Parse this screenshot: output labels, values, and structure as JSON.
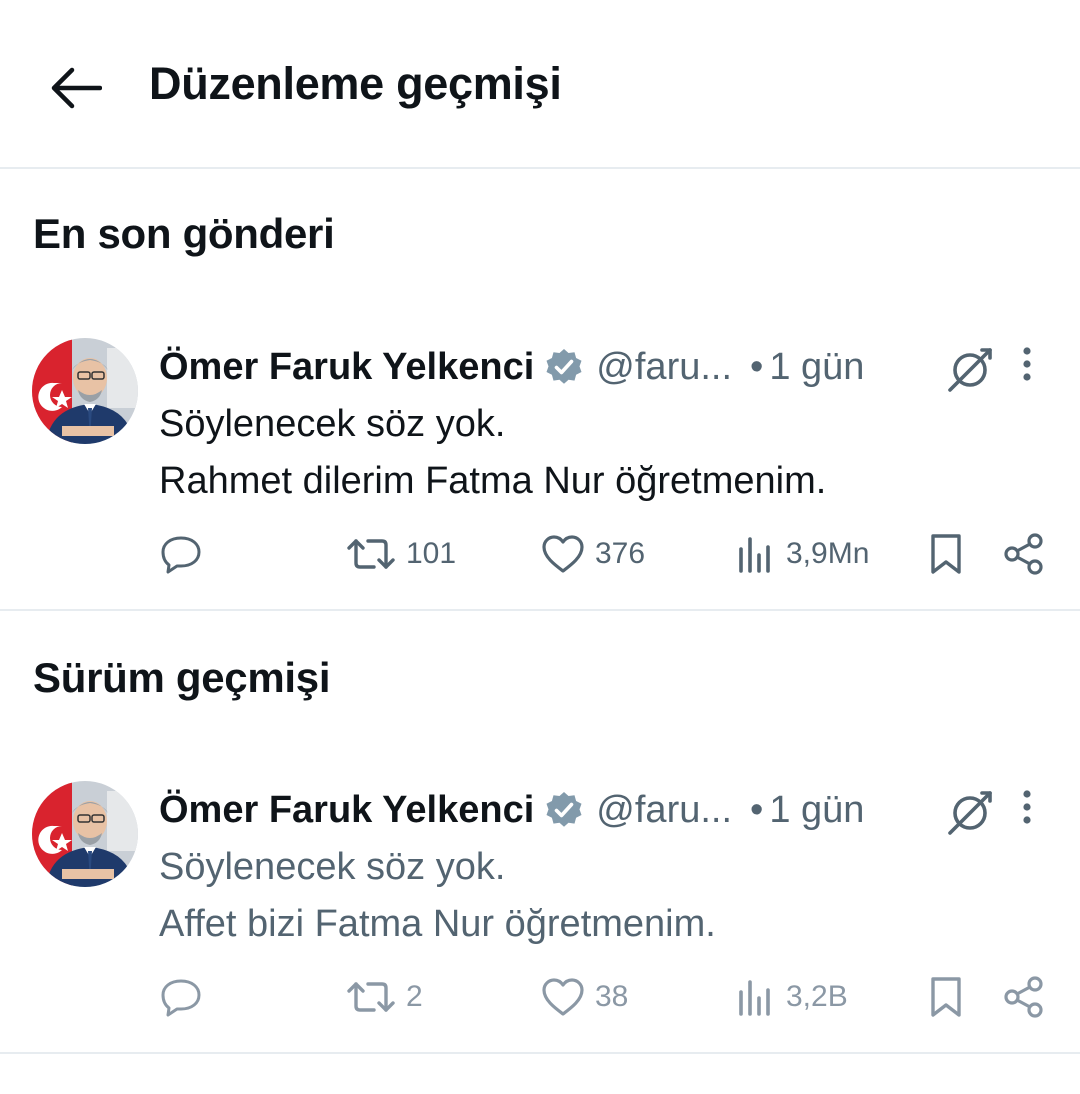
{
  "header": {
    "title": "Düzenleme geçmişi",
    "back_icon": "arrow-left-icon"
  },
  "sections": {
    "latest_heading": "En son gönderi",
    "history_heading": "Sürüm geçmişi"
  },
  "latest_post": {
    "author_name": "Ömer Faruk Yelkenci",
    "handle": "@faru...",
    "dot": "•",
    "time": "1 gün",
    "text_line1": "Söylenecek söz yok.",
    "text_line2": "Rahmet dilerim Fatma Nur öğretmenim.",
    "retweets": "101",
    "likes": "376",
    "views": "3,9Mn"
  },
  "history_post": {
    "author_name": "Ömer Faruk Yelkenci",
    "handle": "@faru...",
    "dot": "•",
    "time": "1 gün",
    "text_line1": "Söylenecek söz yok.",
    "text_line2": "Affet bizi Fatma Nur öğretmenim.",
    "retweets": "2",
    "likes": "38",
    "views": "3,2B"
  },
  "colors": {
    "text_primary": "#0f1419",
    "text_secondary": "#536471",
    "text_muted": "#8b98a5",
    "verified_badge": "#829aab",
    "divider": "#e7ecf0"
  },
  "icons": [
    "arrow-left-icon",
    "verified-badge-icon",
    "edited-icon",
    "more-vertical-icon",
    "reply-icon",
    "retweet-icon",
    "like-icon",
    "views-icon",
    "bookmark-icon",
    "share-icon"
  ]
}
